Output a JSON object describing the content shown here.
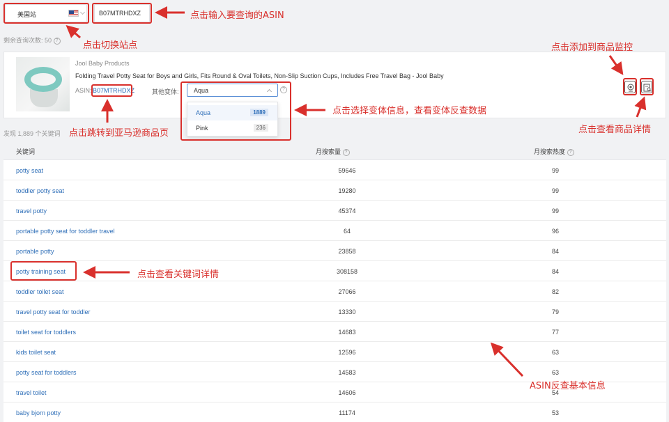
{
  "search": {
    "site_label": "美国站",
    "asin_value": "B07MTRHDXZ",
    "remaining_label": "剩余查询次数: 50"
  },
  "product": {
    "brand": "Jool Baby Products",
    "title": "Folding Travel Potty Seat for Boys and Girls, Fits Round & Oval Toilets, Non-Slip Suction Cups, Includes Free Travel Bag - Jool Baby",
    "asin_label": "ASIN:",
    "asin": "B07MTRHDXZ",
    "variant_label": "其他变体:",
    "variant_selected": "Aqua",
    "variants": [
      {
        "name": "Aqua",
        "count": "1889"
      },
      {
        "name": "Pink",
        "count": "236"
      }
    ]
  },
  "results": {
    "found_label": "发现 1,889 个关键词",
    "columns": [
      "关键词",
      "月搜索量",
      "月搜索热度"
    ],
    "rows": [
      {
        "keyword": "potty seat",
        "volume": "59646",
        "heat": "99"
      },
      {
        "keyword": "toddler potty seat",
        "volume": "19280",
        "heat": "99"
      },
      {
        "keyword": "travel potty",
        "volume": "45374",
        "heat": "99"
      },
      {
        "keyword": "portable potty seat for toddler travel",
        "volume": "64",
        "heat": "96"
      },
      {
        "keyword": "portable potty",
        "volume": "23858",
        "heat": "84"
      },
      {
        "keyword": "potty training seat",
        "volume": "308158",
        "heat": "84"
      },
      {
        "keyword": "toddler toilet seat",
        "volume": "27066",
        "heat": "82"
      },
      {
        "keyword": "travel potty seat for toddler",
        "volume": "13330",
        "heat": "79"
      },
      {
        "keyword": "toilet seat for toddlers",
        "volume": "14683",
        "heat": "77"
      },
      {
        "keyword": "kids toilet seat",
        "volume": "12596",
        "heat": "63"
      },
      {
        "keyword": "potty seat for toddlers",
        "volume": "14583",
        "heat": "63"
      },
      {
        "keyword": "travel toilet",
        "volume": "14606",
        "heat": "54"
      },
      {
        "keyword": "baby bjorn potty",
        "volume": "11174",
        "heat": "53"
      }
    ]
  },
  "annotations": {
    "switch_site": "点击切换站点",
    "enter_asin": "点击输入要查询的ASIN",
    "go_amazon": "点击跳转到亚马逊商品页",
    "select_variant": "点击选择变体信息，查看变体反查数据",
    "add_monitor": "点击添加到商品监控",
    "view_detail": "点击查看商品详情",
    "keyword_detail": "点击查看关键词详情",
    "basic_info": "ASIN反查基本信息"
  },
  "colors": {
    "annotation_red": "#d9302c",
    "link_blue": "#2f6fb8",
    "accent_aqua": "#7ec9c0"
  },
  "icons": {
    "site_flag": "us-flag-icon",
    "help": "question-circle-icon",
    "monitor": "monitor-eye-icon",
    "detail": "document-search-icon"
  }
}
